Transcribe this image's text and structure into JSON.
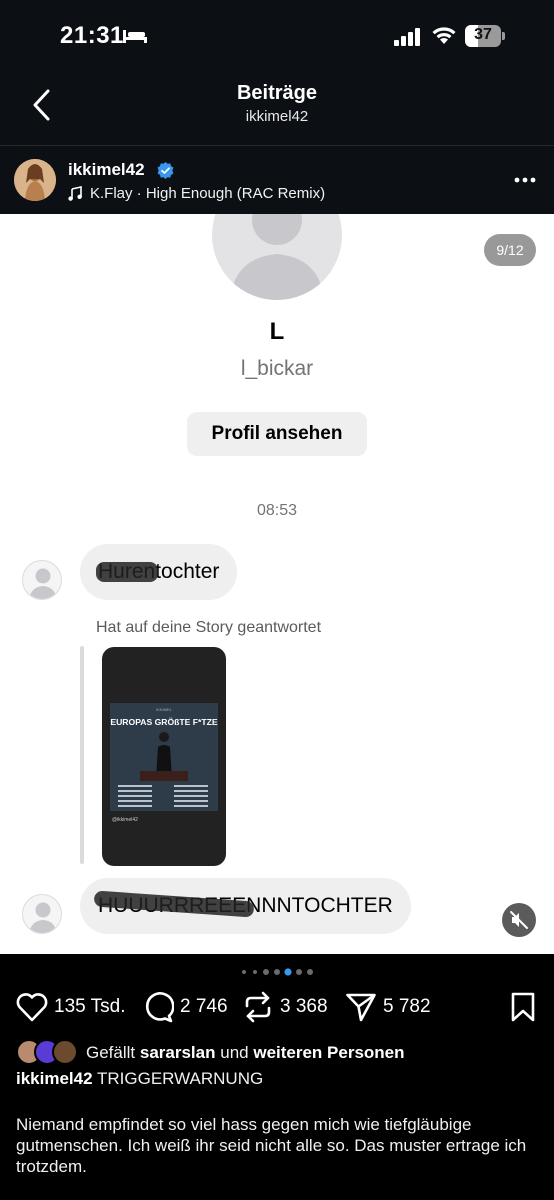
{
  "status_bar": {
    "time": "21:31",
    "battery": "37",
    "battery_level": 0.37
  },
  "header": {
    "title": "Beiträge",
    "subtitle": "ikkimel42"
  },
  "post": {
    "author": "ikkimel42",
    "music": "K.Flay · High Enough (RAC Remix)",
    "counter": "9/12",
    "carousel_dots": 7,
    "carousel_active": 4
  },
  "dm": {
    "name": "L",
    "username": "l_bickar",
    "profile_button": "Profil ansehen",
    "time": "08:53",
    "message1": "Hurentochter",
    "story_note": "Hat auf deine Story geantwortet",
    "poster_brand": "IKKIMEL",
    "poster_title": "EUROPAS GRÖßTE F*TZE",
    "poster_handle": "@ikkimel42",
    "message2": "HUUURRREEENNNTOCHTER"
  },
  "actions": {
    "likes": "135 Tsd.",
    "comments": "2 746",
    "reposts": "3 368",
    "shares": "5 782"
  },
  "likes_line": {
    "prefix": "Gefällt",
    "user": "sararslan",
    "middle": "und",
    "rest": "weiteren Personen"
  },
  "caption": {
    "user": "ikkimel42",
    "headline": "TRIGGERWARNUNG",
    "body": "Niemand empfindet so viel hass gegen mich wie tiefgläubige gutmenschen. Ich weiß ihr seid nicht alle so. Das muster ertrage ich trotzdem."
  },
  "colors": {
    "background": "#000000",
    "header": "#0c1014",
    "bubble": "#efefef",
    "verified": "#3897f0",
    "active_dot": "#3897f0"
  },
  "icons": [
    "back-icon",
    "verified-icon",
    "music-icon",
    "more-icon",
    "mute-icon",
    "heart-icon",
    "comment-icon",
    "repost-icon",
    "share-icon",
    "bookmark-icon"
  ]
}
